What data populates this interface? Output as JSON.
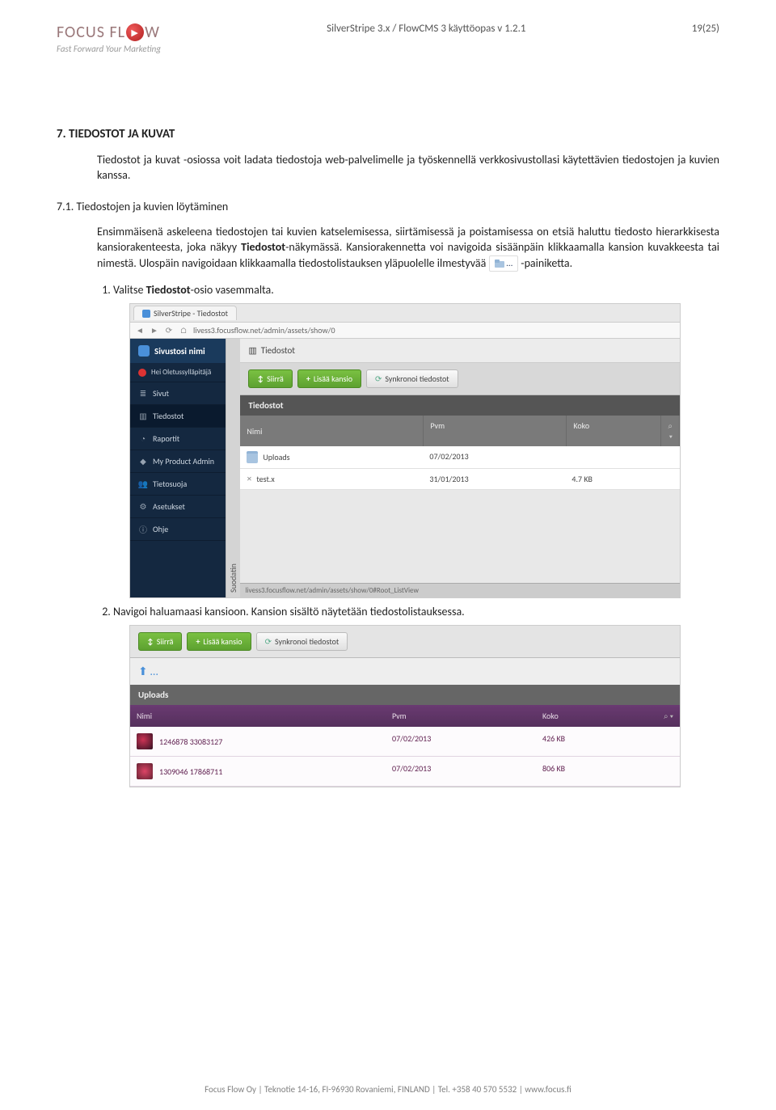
{
  "header": {
    "logo_text_a": "FOCUS",
    "logo_text_b": "FL",
    "logo_text_c": "W",
    "logo_play": "▶",
    "tagline": "Fast Forward Your Marketing",
    "center": "SilverStripe 3.x / FlowCMS 3 käyttöopas v 1.2.1",
    "right": "19(25)"
  },
  "section": {
    "num": "7.",
    "title": "TIEDOSTOT JA KUVAT",
    "intro": "Tiedostot ja kuvat -osiossa voit ladata tiedostoja web-palvelimelle ja työskennellä verkkosivustollasi käytettävien tiedostojen ja kuvien kanssa.",
    "sub_num": "7.1.",
    "sub_title": "Tiedostojen ja kuvien löytäminen",
    "p1a": "Ensimmäisenä askeleena tiedostojen tai kuvien katselemisessa, siirtämisessä ja poistamisessa on etsiä haluttu tiedosto hierarkkisesta kansiorakenteesta, joka näkyy ",
    "p1b": "Tiedostot",
    "p1c": "-näkymässä. Kansiorakennetta voi navigoida sisäänpäin klikkaamalla kansion kuvakkeesta tai nimestä. Ulospäin navigoidaan klikkaamalla tiedostolistauksen yläpuolelle ilmestyvää ",
    "p1d": " -painiketta.",
    "inline_folder": "…",
    "step1a": "Valitse ",
    "step1b": "Tiedostot",
    "step1c": "-osio vasemmalta.",
    "step2": "Navigoi haluamaasi kansioon. Kansion sisältö näytetään tiedostolistauksessa."
  },
  "shot1": {
    "tab": "SilverStripe - Tiedostot",
    "url": "livess3.focusflow.net/admin/assets/show/0",
    "site": "Sivustosi nimi",
    "user": "Hei Oletussylläpitäjä",
    "nav": [
      "Sivut",
      "Tiedostot",
      "Raportit",
      "My Product Admin",
      "Tietosuoja",
      "Asetukset",
      "Ohje"
    ],
    "suodatin": "Suodatin",
    "crumb": "Tiedostot",
    "btn_siirra": "Siirrä",
    "btn_lisaa": "Lisää kansio",
    "btn_synk": "Synkronoi tiedostot",
    "grid_title": "Tiedostot",
    "col_name": "Nimi",
    "col_date": "Pvm",
    "col_size": "Koko",
    "search_glyph": "⌕ ▾",
    "rows": [
      {
        "name": "Uploads",
        "date": "07/02/2013",
        "size": ""
      },
      {
        "name": "test.x",
        "date": "31/01/2013",
        "size": "4.7 KB"
      }
    ],
    "footer_url": "livess3.focusflow.net/admin/assets/show/0#Root_ListView"
  },
  "shot2": {
    "btn_siirra": "Siirrä",
    "btn_lisaa": "Lisää kansio",
    "btn_synk": "Synkronoi tiedostot",
    "up": "⬆ …",
    "grid_title": "Uploads",
    "col_name": "Nimi",
    "col_date": "Pvm",
    "col_size": "Koko",
    "search_glyph": "⌕ ▾",
    "rows": [
      {
        "name": "1246878 33083127",
        "date": "07/02/2013",
        "size": "426 KB"
      },
      {
        "name": "1309046 17868711",
        "date": "07/02/2013",
        "size": "806 KB"
      }
    ]
  },
  "footer": "Focus Flow Oy  |  Teknotie 14-16, FI-96930 Rovaniemi, FINLAND  |  Tel. +358 40 570 5532  |  www.focus.fi"
}
